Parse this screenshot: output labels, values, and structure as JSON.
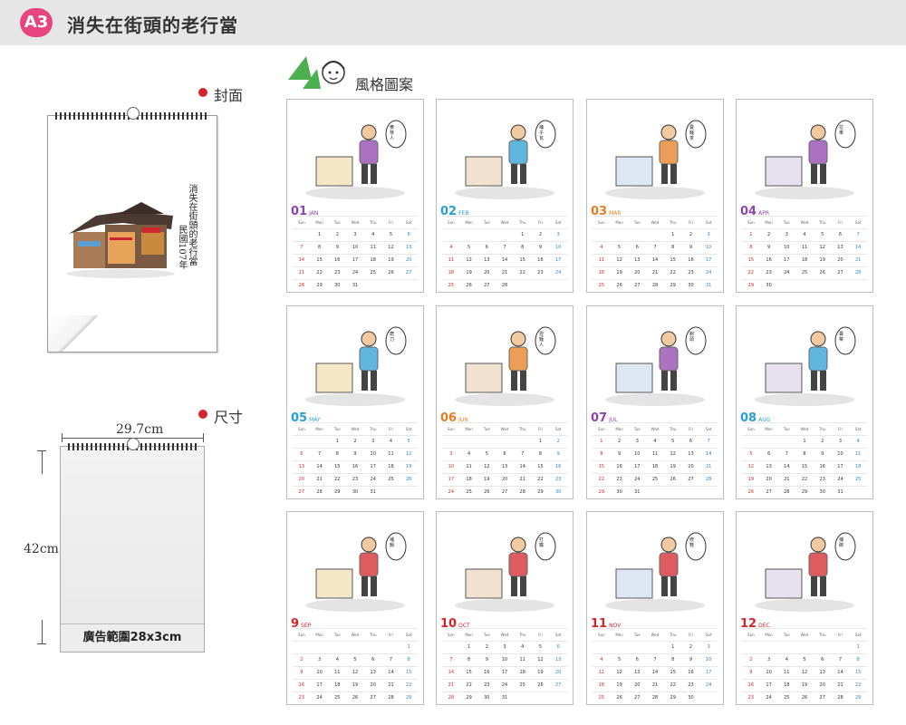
{
  "header": {
    "badge": "A3",
    "title": "消失在街頭的老行當"
  },
  "cover_section": {
    "label": "封面",
    "cover_text_col1": "消失在街頭的老行當",
    "cover_text_col2": "民國107年"
  },
  "size_section": {
    "label": "尺寸",
    "width": "29.7cm",
    "height": "42cm",
    "ad_area": "廣告範圍28x3cm"
  },
  "style_section": {
    "label": "風格圖案"
  },
  "months": [
    {
      "num": "01",
      "abbr": "JAN",
      "color": "#8e44ad",
      "scene": "麥芽人"
    },
    {
      "num": "02",
      "abbr": "FEB",
      "color": "#2a9fd6",
      "scene": "補子瓦"
    },
    {
      "num": "03",
      "abbr": "MAR",
      "color": "#e67e22",
      "scene": "賣麵茶"
    },
    {
      "num": "04",
      "abbr": "APR",
      "color": "#8e44ad",
      "scene": "拉車"
    },
    {
      "num": "05",
      "abbr": "MAY",
      "color": "#2a9fd6",
      "scene": "磨刀"
    },
    {
      "num": "06",
      "abbr": "JUN",
      "color": "#e67e22",
      "scene": "捏麵人"
    },
    {
      "num": "07",
      "abbr": "JUL",
      "color": "#8e44ad",
      "scene": "剃頭"
    },
    {
      "num": "08",
      "abbr": "AUG",
      "color": "#2a9fd6",
      "scene": "賣菜"
    },
    {
      "num": "9",
      "abbr": "SEP",
      "color": "#d3262b",
      "scene": "補鍋"
    },
    {
      "num": "10",
      "abbr": "OCT",
      "color": "#d3262b",
      "scene": "打鐵"
    },
    {
      "num": "11",
      "abbr": "NOV",
      "color": "#d3262b",
      "scene": "修鞋"
    },
    {
      "num": "12",
      "abbr": "DEC",
      "color": "#d3262b",
      "scene": "補碗"
    }
  ],
  "weekdays": [
    "Sun",
    "Mon",
    "Tue",
    "Wed",
    "Thu",
    "Fri",
    "Sat"
  ]
}
